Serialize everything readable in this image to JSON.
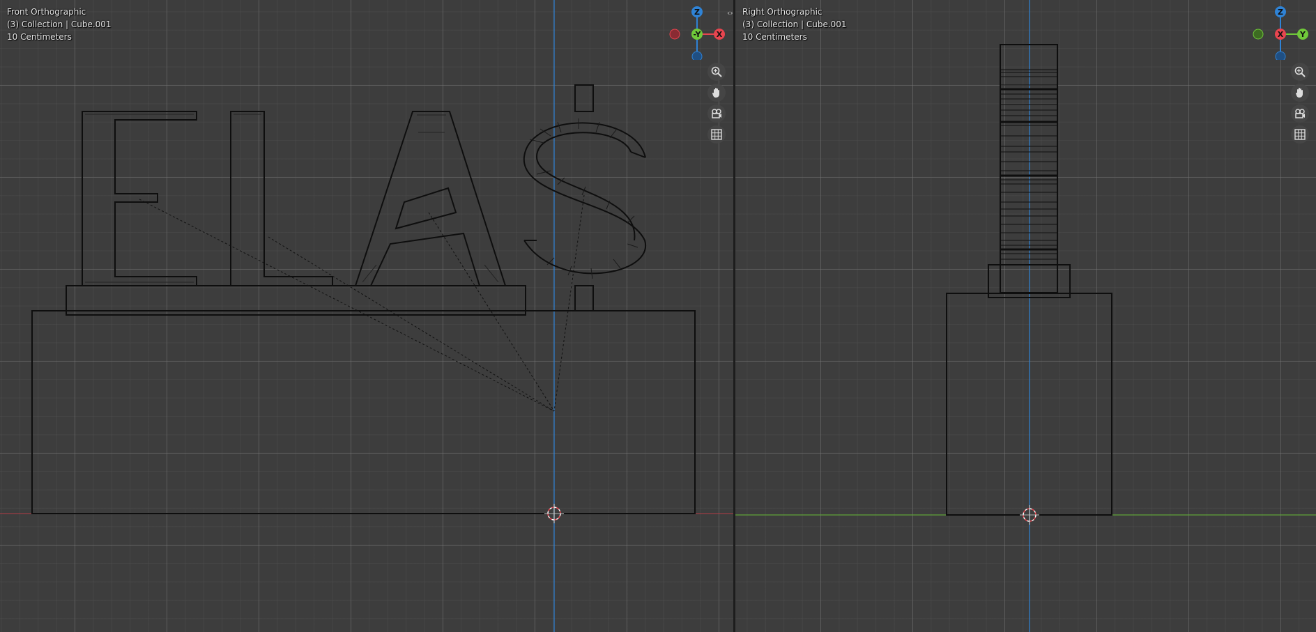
{
  "front_view": {
    "view_name": "Front Orthographic",
    "collection": "(3) Collection | Cube.001",
    "scale": "10 Centimeters",
    "gizmo": {
      "top": "Z",
      "center": "-Y",
      "right": "X"
    },
    "tools": [
      "zoom-icon",
      "hand-pan-icon",
      "camera-icon",
      "grid-icon"
    ]
  },
  "right_view": {
    "view_name": "Right Orthographic",
    "collection": "(3) Collection | Cube.001",
    "scale": "10 Centimeters",
    "gizmo": {
      "top": "Z",
      "center": "X",
      "right": "Y"
    },
    "tools": [
      "zoom-icon",
      "hand-pan-icon",
      "camera-icon",
      "grid-icon"
    ]
  },
  "colors": {
    "background": "#3d3d3d",
    "x_axis": "#e8454f",
    "y_axis": "#70c93a",
    "z_axis": "#2f83d6",
    "wire": "#0e0e0e"
  }
}
